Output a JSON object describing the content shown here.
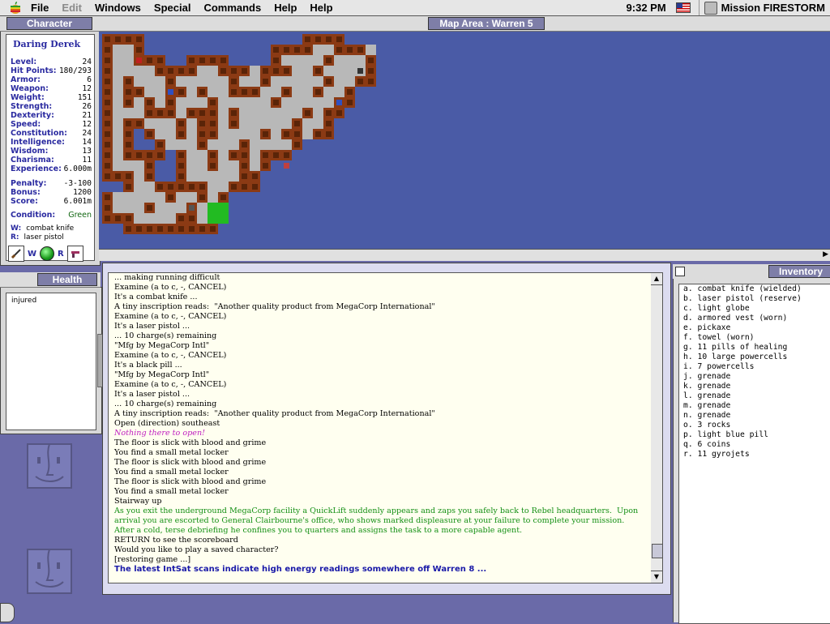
{
  "menubar": {
    "items": [
      "File",
      "Edit",
      "Windows",
      "Special",
      "Commands",
      "Help",
      "Help"
    ],
    "clock": "9:32 PM",
    "app_name": "Mission FIRESTORM"
  },
  "character": {
    "title": "Character",
    "name": "Daring Derek",
    "stats": [
      {
        "label": "Level:",
        "value": "24"
      },
      {
        "label": "Hit Points:",
        "value": "180/293"
      },
      {
        "label": "Armor:",
        "value": "6"
      },
      {
        "label": "Weapon:",
        "value": "12"
      },
      {
        "label": "Weight:",
        "value": "151"
      },
      {
        "label": "Strength:",
        "value": "26"
      },
      {
        "label": "Dexterity:",
        "value": "21"
      },
      {
        "label": "Speed:",
        "value": "12"
      },
      {
        "label": "Constitution:",
        "value": "24"
      },
      {
        "label": "Intelligence:",
        "value": "14"
      },
      {
        "label": "Wisdom:",
        "value": "13"
      },
      {
        "label": "Charisma:",
        "value": "11"
      },
      {
        "label": "Experience:",
        "value": "6.000m"
      }
    ],
    "scores": [
      {
        "label": "Penalty:",
        "value": "-3-100"
      },
      {
        "label": "Bonus:",
        "value": "1200"
      },
      {
        "label": "Score:",
        "value": "6.001m"
      }
    ],
    "condition_label": "Condition:",
    "condition_value": "Green",
    "wield_label": "W:",
    "wield_value": "combat knife",
    "ready_label": "R:",
    "ready_value": "laser pistol",
    "w_letter": "W",
    "r_letter": "R"
  },
  "health": {
    "title": "Health",
    "status": "injured"
  },
  "map": {
    "title": "Map Area : Warren 5"
  },
  "log": {
    "lines": [
      {
        "text": "... making running difficult",
        "style": "normal"
      },
      {
        "text": "Examine (a to c, -, CANCEL)",
        "style": "normal"
      },
      {
        "text": "It's a combat knife ...",
        "style": "normal"
      },
      {
        "text": "A tiny inscription reads:  \"Another quality product from MegaCorp International\"",
        "style": "normal"
      },
      {
        "text": "Examine (a to c, -, CANCEL)",
        "style": "normal"
      },
      {
        "text": "It's a laser pistol ...",
        "style": "normal"
      },
      {
        "text": "... 10 charge(s) remaining",
        "style": "normal"
      },
      {
        "text": "\"Mfg by MegaCorp Intl\"",
        "style": "normal"
      },
      {
        "text": "Examine (a to c, -, CANCEL)",
        "style": "normal"
      },
      {
        "text": "It's a black pill ...",
        "style": "normal"
      },
      {
        "text": "\"Mfg by MegaCorp Intl\"",
        "style": "normal"
      },
      {
        "text": "Examine (a to c, -, CANCEL)",
        "style": "normal"
      },
      {
        "text": "It's a laser pistol ...",
        "style": "normal"
      },
      {
        "text": "... 10 charge(s) remaining",
        "style": "normal"
      },
      {
        "text": "A tiny inscription reads:  \"Another quality product from MegaCorp International\"",
        "style": "normal"
      },
      {
        "text": "Open (direction) southeast",
        "style": "normal"
      },
      {
        "text": "Nothing there to open!",
        "style": "magenta"
      },
      {
        "text": "The floor is slick with blood and grime",
        "style": "normal"
      },
      {
        "text": "You find a small metal locker",
        "style": "normal"
      },
      {
        "text": "The floor is slick with blood and grime",
        "style": "normal"
      },
      {
        "text": "You find a small metal locker",
        "style": "normal"
      },
      {
        "text": "The floor is slick with blood and grime",
        "style": "normal"
      },
      {
        "text": "You find a small metal locker",
        "style": "normal"
      },
      {
        "text": "Stairway up",
        "style": "normal"
      },
      {
        "text": "As you exit the underground MegaCorp facility a QuickLift suddenly appears and zaps you safely back to Rebel headquarters.  Upon",
        "style": "green"
      },
      {
        "text": "arrival you are escorted to General Clairbourne's office, who shows marked displeasure at your failure to complete your mission.",
        "style": "green"
      },
      {
        "text": "After a cold, terse debriefing he confines you to quarters and assigns the task to a more capable agent.",
        "style": "green"
      },
      {
        "text": "RETURN to see the scoreboard",
        "style": "normal"
      },
      {
        "text": "Would you like to play a saved character?",
        "style": "normal"
      },
      {
        "text": "[restoring game ...]",
        "style": "normal"
      },
      {
        "text": "The latest IntSat scans indicate high energy readings somewhere off Warren 8 ...",
        "style": "blue"
      }
    ]
  },
  "inventory": {
    "title": "Inventory",
    "items": [
      "a. combat knife (wielded)",
      "b. laser pistol (reserve)",
      "c. light globe",
      "d. armored vest (worn)",
      "e. pickaxe",
      "f. towel (worn)",
      "g. 11 pills of healing",
      "h. 10 large powercells",
      "i. 7 powercells",
      "j. grenade",
      "k. grenade",
      "l. grenade",
      "m. grenade",
      "n. grenade",
      "o. 3 rocks",
      "p. light blue pill",
      "q. 6 coins",
      "r. 11 gyrojets"
    ]
  },
  "colors": {
    "wall": "#8b3a14",
    "wall_inner": "#5a2408",
    "floor": "#b8b8b8",
    "water": "#4a5ba6",
    "exit": "#22bb22"
  }
}
